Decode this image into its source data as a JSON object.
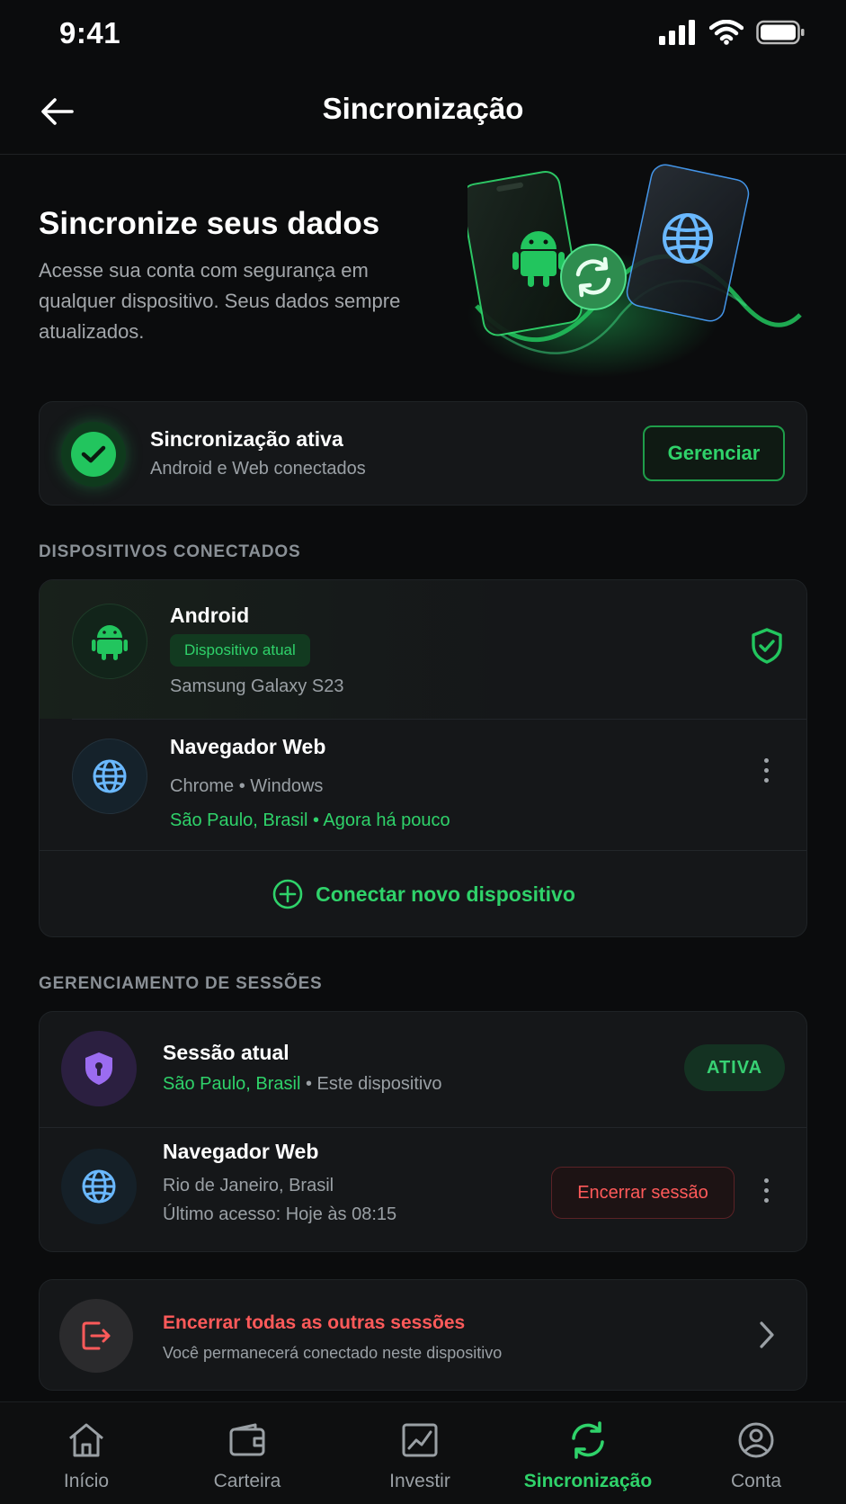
{
  "status_bar": {
    "time": "9:41"
  },
  "header": {
    "title": "Sincronização"
  },
  "hero": {
    "title": "Sincronize seus dados",
    "description": "Acesse sua conta com segurança em qualquer dispositivo. Seus dados sempre atualizados."
  },
  "sync_status": {
    "title": "Sincronização ativa",
    "subtitle": "Android e Web conectados",
    "manage_label": "Gerenciar"
  },
  "devices": {
    "section_label": "DISPOSITIVOS CONECTADOS",
    "items": [
      {
        "name": "Android",
        "badge": "Dispositivo atual",
        "detail": "Samsung Galaxy S23",
        "icon": "android-icon"
      },
      {
        "name": "Navegador Web",
        "detail": "Chrome • Windows",
        "location": "São Paulo, Brasil • Agora há pouco",
        "icon": "globe-icon"
      }
    ],
    "connect_label": "Conectar novo dispositivo"
  },
  "sessions": {
    "section_label": "GERENCIAMENTO DE SESSÕES",
    "current": {
      "name": "Sessão atual",
      "location": "São Paulo, Brasil",
      "detail": "• Este dispositivo",
      "badge": "ATIVA"
    },
    "web": {
      "name": "Navegador Web",
      "location": "Rio de Janeiro, Brasil",
      "last_access": "Último acesso: Hoje às 08:15",
      "end_label": "Encerrar sessão"
    }
  },
  "end_all": {
    "title": "Encerrar todas as outras sessões",
    "subtitle": "Você permanecerá conectado neste dispositivo"
  },
  "tabbar": {
    "tabs": [
      {
        "label": "Início",
        "icon": "home-icon"
      },
      {
        "label": "Carteira",
        "icon": "wallet-icon"
      },
      {
        "label": "Investir",
        "icon": "chart-icon"
      },
      {
        "label": "Sincronização",
        "icon": "sync-icon",
        "active": true
      },
      {
        "label": "Conta",
        "icon": "profile-icon"
      }
    ]
  },
  "colors": {
    "accent": "#2fd26a",
    "danger": "#ff5a5a",
    "background": "#0b0c0d",
    "card": "#151719"
  }
}
